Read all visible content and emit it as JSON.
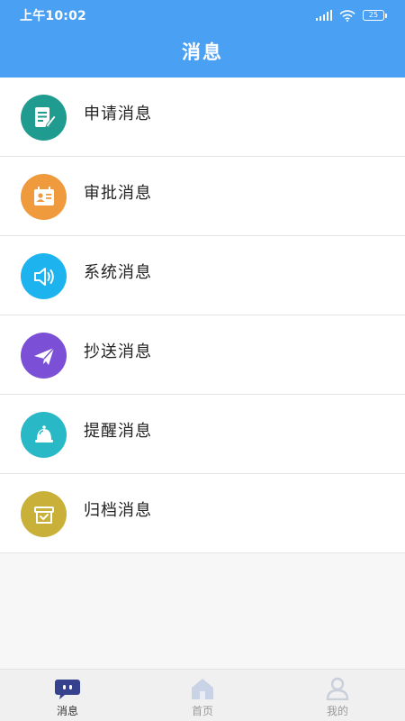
{
  "status_bar": {
    "time": "上午10:02",
    "battery": "25"
  },
  "header": {
    "title": "消息"
  },
  "messages": [
    {
      "label": "申请消息",
      "icon": "document-edit-icon",
      "color": "#1f9c8f"
    },
    {
      "label": "审批消息",
      "icon": "id-card-icon",
      "color": "#f09a3e"
    },
    {
      "label": "系统消息",
      "icon": "speaker-icon",
      "color": "#1db3ee"
    },
    {
      "label": "抄送消息",
      "icon": "paper-plane-icon",
      "color": "#7b4fd6"
    },
    {
      "label": "提醒消息",
      "icon": "bell-icon",
      "color": "#29b8c6"
    },
    {
      "label": "归档消息",
      "icon": "archive-box-icon",
      "color": "#c9b038"
    }
  ],
  "tabbar": {
    "tabs": [
      {
        "label": "消息",
        "icon": "chat-bubble-icon",
        "active": true
      },
      {
        "label": "首页",
        "icon": "home-icon",
        "active": false
      },
      {
        "label": "我的",
        "icon": "person-icon",
        "active": false
      }
    ]
  }
}
